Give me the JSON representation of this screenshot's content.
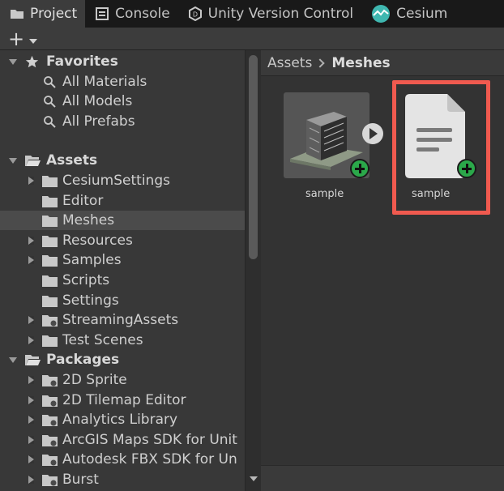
{
  "tabs": [
    {
      "label": "Project",
      "icon": "folder-icon",
      "active": true
    },
    {
      "label": "Console",
      "icon": "console-icon",
      "active": false
    },
    {
      "label": "Unity Version Control",
      "icon": "version-control-icon",
      "active": false
    },
    {
      "label": "Cesium",
      "icon": "cesium-icon",
      "active": false
    }
  ],
  "toolbar": {
    "add_label": "+",
    "add_icon": "plus-icon"
  },
  "tree": {
    "favorites": {
      "label": "Favorites",
      "items": [
        "All Materials",
        "All Models",
        "All Prefabs"
      ]
    },
    "assets": {
      "label": "Assets",
      "items": [
        {
          "label": "CesiumSettings",
          "expandable": true
        },
        {
          "label": "Editor",
          "expandable": false
        },
        {
          "label": "Meshes",
          "expandable": false,
          "selected": true
        },
        {
          "label": "Resources",
          "expandable": true
        },
        {
          "label": "Samples",
          "expandable": true
        },
        {
          "label": "Scripts",
          "expandable": false
        },
        {
          "label": "Settings",
          "expandable": false
        },
        {
          "label": "StreamingAssets",
          "expandable": true
        },
        {
          "label": "Test Scenes",
          "expandable": true
        }
      ]
    },
    "packages": {
      "label": "Packages",
      "items": [
        "2D Sprite",
        "2D Tilemap Editor",
        "Analytics Library",
        "ArcGIS Maps SDK for Unit",
        "Autodesk FBX SDK for Un",
        "Burst"
      ]
    }
  },
  "breadcrumb": {
    "root": "Assets",
    "current": "Meshes"
  },
  "grid": {
    "items": [
      {
        "label": "sample",
        "type": "model"
      },
      {
        "label": "sample",
        "type": "document"
      }
    ]
  },
  "colors": {
    "highlight": "#f05a4f",
    "add_badge": "#2ba84a",
    "cesium_teal": "#3fb7b0"
  }
}
